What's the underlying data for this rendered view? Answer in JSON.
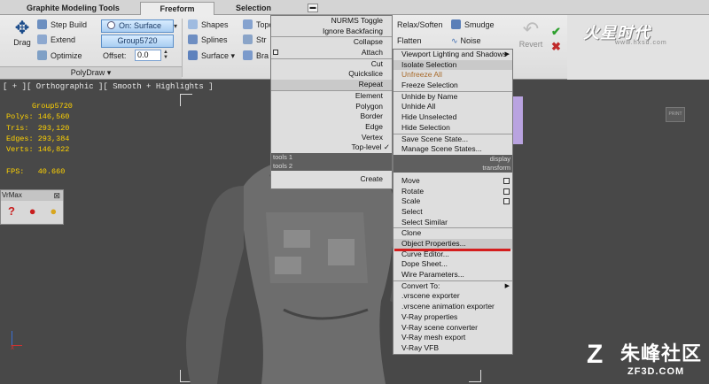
{
  "ribbon": {
    "tabs": [
      "Graphite Modeling Tools",
      "Freeform",
      "Selection"
    ],
    "tab_menu_icon": "▬",
    "drag_label": "Drag",
    "step_build": "Step Build",
    "extend": "Extend",
    "optimize": "Optimize",
    "on_surface": "On: Surface",
    "group_button": "Group5720",
    "offset_label": "Offset:",
    "offset_value": "0.0",
    "shapes": "Shapes",
    "splines": "Splines",
    "surface": "Surface",
    "topo": "Topo",
    "strips": "Str",
    "branches": "Bra",
    "relax_soften": "Relax/Soften",
    "smudge": "Smudge",
    "flatten": "Flatten",
    "noise": "Noise",
    "revert": "Revert",
    "panel_label": "PolyDraw",
    "panel_arrow": "▾",
    "logo_text": "火星时代",
    "logo_sub": "www.hxsd.com"
  },
  "viewport": {
    "label": "[ + ][ Orthographic ][ Smooth + Highlights ]",
    "stats": {
      "group": "Group5720",
      "polys": "Polys: 146,560",
      "tris": "Tris:  293,120",
      "edges": "Edges: 293,384",
      "verts": "Verts: 146,822",
      "fps": "FPS:   40.660"
    },
    "float_panel_title": "VrMax",
    "float_panel_close": "⊠",
    "mini_thumb": "PRINT"
  },
  "quad_left": {
    "items_top": [
      "NURMS Toggle",
      "Ignore Backfacing",
      "Collapse",
      "Attach",
      "Cut",
      "Quickslice",
      "Repeat",
      "Element",
      "Polygon",
      "Border",
      "Edge",
      "Vertex",
      "Top-level"
    ],
    "section1_left": "tools 1",
    "section2_left": "tools 2",
    "create": "Create"
  },
  "quad_right": {
    "viewport_lighting": "Viewport Lighting and Shadows",
    "isolate_selection": "Isolate Selection",
    "unfreeze_all": "Unfreeze All",
    "freeze_selection": "Freeze Selection",
    "unhide_by_name": "Unhide by Name",
    "unhide_all": "Unhide All",
    "hide_unselected": "Hide Unselected",
    "hide_selection": "Hide Selection",
    "save_scene_state": "Save Scene State...",
    "manage_scene_states": "Manage Scene States...",
    "section1_right": "display",
    "section2_right": "transform",
    "move": "Move",
    "rotate": "Rotate",
    "scale": "Scale",
    "select": "Select",
    "select_similar": "Select Similar",
    "clone": "Clone",
    "object_properties": "Object Properties...",
    "curve_editor": "Curve Editor...",
    "dope_sheet": "Dope Sheet...",
    "wire_parameters": "Wire Parameters...",
    "convert_to": "Convert To:",
    "vrscene_exporter": ".vrscene exporter",
    "vrscene_anim_exporter": ".vrscene animation exporter",
    "vray_properties": "V-Ray properties",
    "vray_scene_converter": "V-Ray scene converter",
    "vray_mesh_export": "V-Ray mesh export",
    "vray_vfb": "V-Ray VFB"
  },
  "watermark": {
    "main": "朱峰社区",
    "sub": "ZF3D.COM",
    "z": "Z"
  },
  "colors": {
    "stats_text": "#ffd200",
    "highlight_red": "#d41e1e",
    "disabled_orange": "#a86a2a",
    "ribbon_blue": "#a9cdf2"
  }
}
